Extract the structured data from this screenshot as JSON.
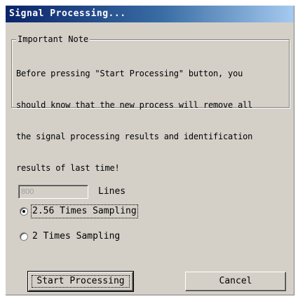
{
  "window": {
    "title": "Signal Processing..."
  },
  "note": {
    "legend": "Important Note",
    "lines": [
      "Before pressing \"Start Processing\" button, you",
      "should know that the new process will remove all",
      "the signal processing results and identification",
      "results of last time!"
    ]
  },
  "lines_field": {
    "value": "800",
    "label": "Lines",
    "enabled": false
  },
  "sampling": {
    "options": [
      {
        "label": "2.56 Times Sampling",
        "selected": true
      },
      {
        "label": "2 Times Sampling",
        "selected": false
      }
    ]
  },
  "buttons": {
    "start_label": "Start Processing",
    "cancel_label": "Cancel"
  },
  "colors": {
    "dialog_face": "#d4d0c8",
    "titlebar_start": "#0a246a",
    "titlebar_end": "#a6caf0",
    "disabled_text": "#a0a0a0"
  }
}
